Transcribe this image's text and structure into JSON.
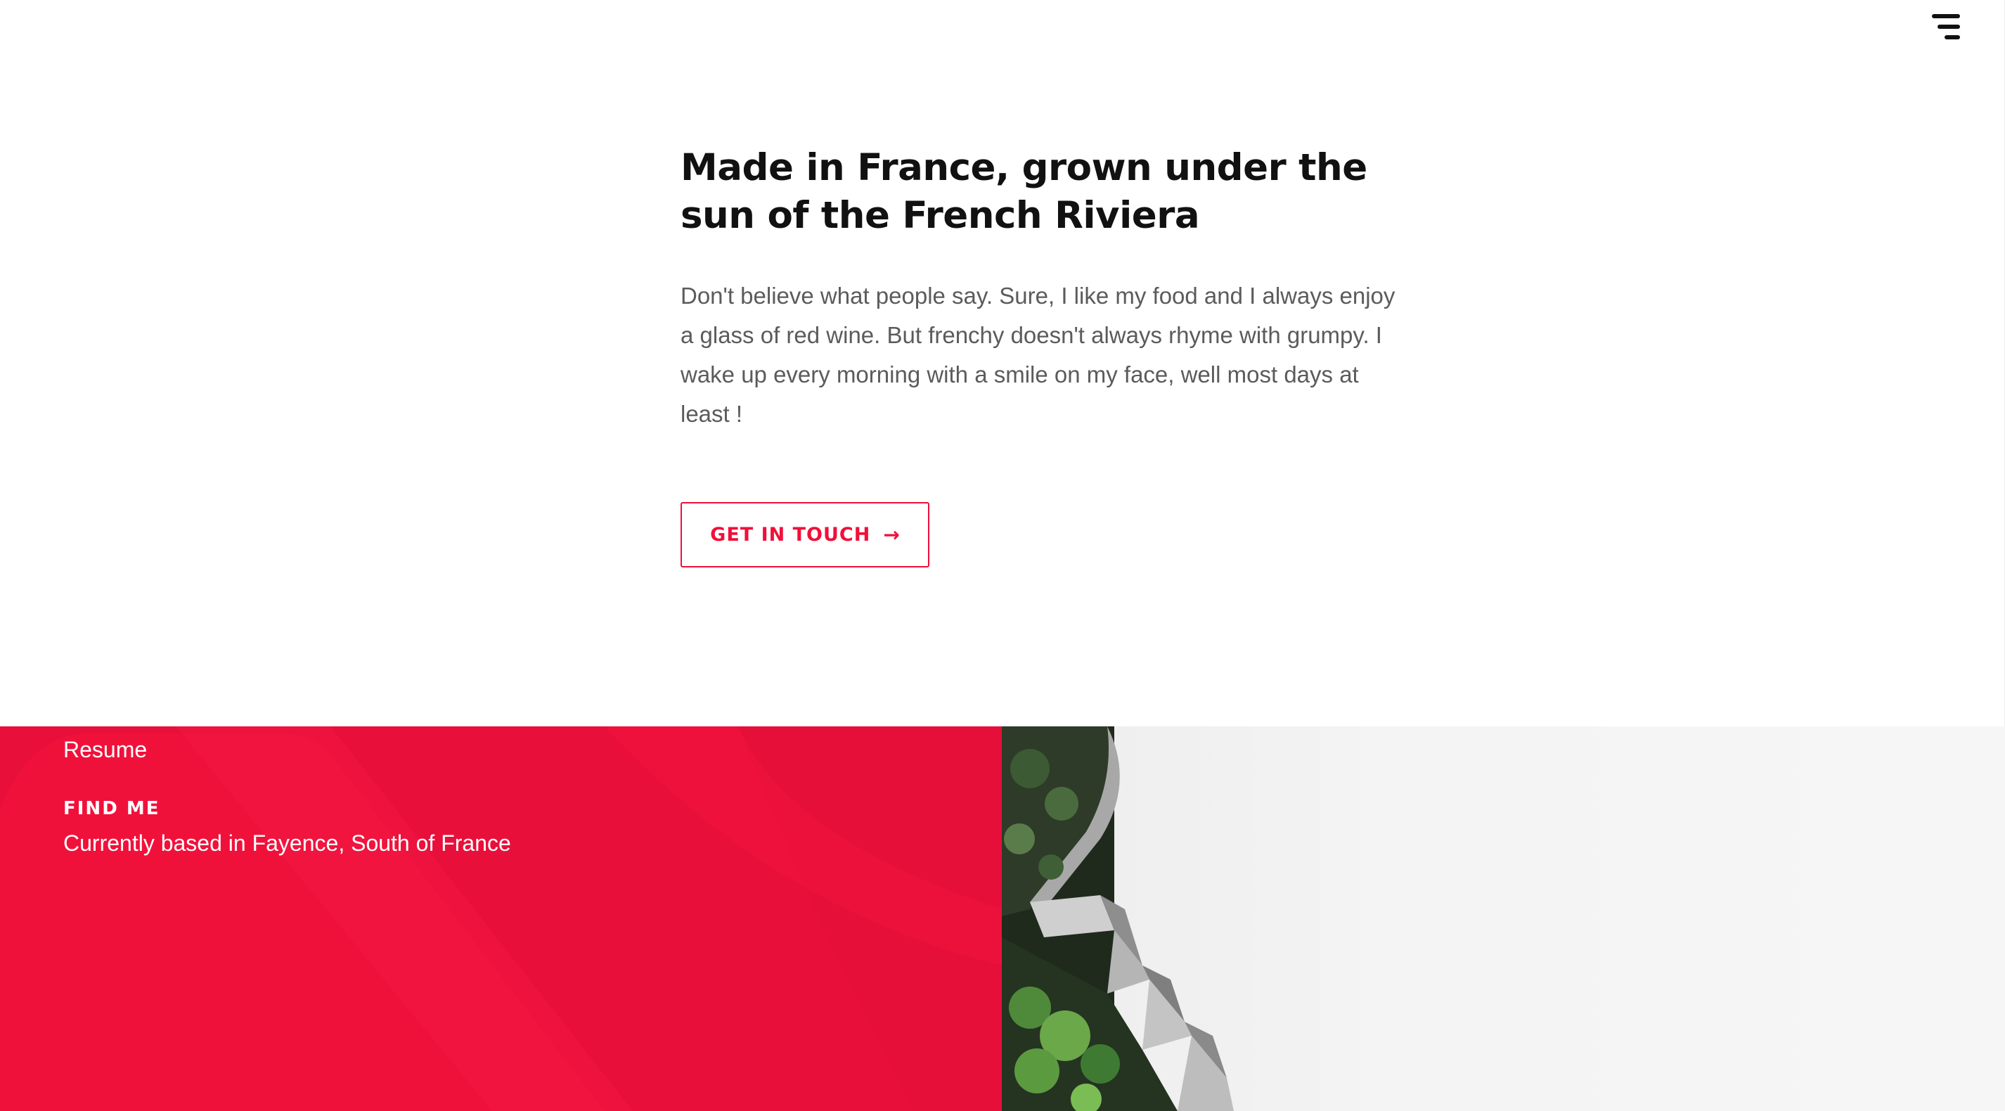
{
  "header": {
    "menu_icon": "hamburger-menu-icon"
  },
  "intro": {
    "heading": "Made in France, grown under the sun of the French Riviera",
    "paragraph": "Don't believe what people say. Sure, I like my food and I always enjoy a glass of red wine. But frenchy doesn't always rhyme with grumpy. I wake up every morning with a smile on my face, well most days at least !",
    "cta_label": "GET IN TOUCH",
    "cta_arrow": "→"
  },
  "footer": {
    "resume_link": "Resume",
    "find_me_heading": "FIND ME",
    "location": "Currently based in Fayence, South of France"
  },
  "colors": {
    "accent": "#f0103a",
    "panel_red": "#e8103a",
    "heading": "#111111",
    "body_text": "#5b5b5b"
  }
}
